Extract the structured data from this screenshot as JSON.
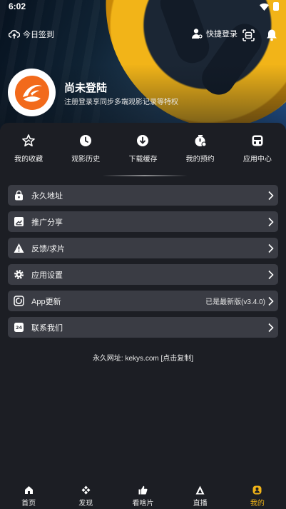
{
  "status_bar": {
    "time": "6:02"
  },
  "top_bar": {
    "checkin_label": "今日签到",
    "quick_login_label": "快捷登录"
  },
  "profile": {
    "name": "尚未登陆",
    "subtitle": "注册登录享同步多端观影记录等特权"
  },
  "quick_actions": [
    {
      "label": "我的收藏",
      "icon": "star-icon"
    },
    {
      "label": "观影历史",
      "icon": "clock-icon"
    },
    {
      "label": "下载缓存",
      "icon": "download-icon"
    },
    {
      "label": "我的预约",
      "icon": "reservation-icon"
    },
    {
      "label": "应用中心",
      "icon": "app-center-icon"
    }
  ],
  "menu": [
    {
      "label": "永久地址",
      "icon": "lock-icon",
      "value": ""
    },
    {
      "label": "推广分享",
      "icon": "share-icon",
      "value": ""
    },
    {
      "label": "反馈/求片",
      "icon": "warning-icon",
      "value": ""
    },
    {
      "label": "应用设置",
      "icon": "gear-icon",
      "value": ""
    },
    {
      "label": "App更新",
      "icon": "update-icon",
      "value": "已是最新版(v3.4.0)"
    },
    {
      "label": "联系我们",
      "icon": "contact-24-icon",
      "value": ""
    }
  ],
  "website_text": "永久网址: kekys.com [点击复制]",
  "bottom_nav": [
    {
      "label": "首页",
      "icon": "home-icon",
      "active": false
    },
    {
      "label": "发现",
      "icon": "discover-icon",
      "active": false
    },
    {
      "label": "看啥片",
      "icon": "thumbs-up-icon",
      "active": false
    },
    {
      "label": "直播",
      "icon": "live-icon",
      "active": false
    },
    {
      "label": "我的",
      "icon": "profile-icon",
      "active": true
    }
  ],
  "colors": {
    "background": "#1c1e24",
    "menu_row": "#3a3c44",
    "accent": "#f2b418",
    "logo_orange": "#f26a1b"
  }
}
